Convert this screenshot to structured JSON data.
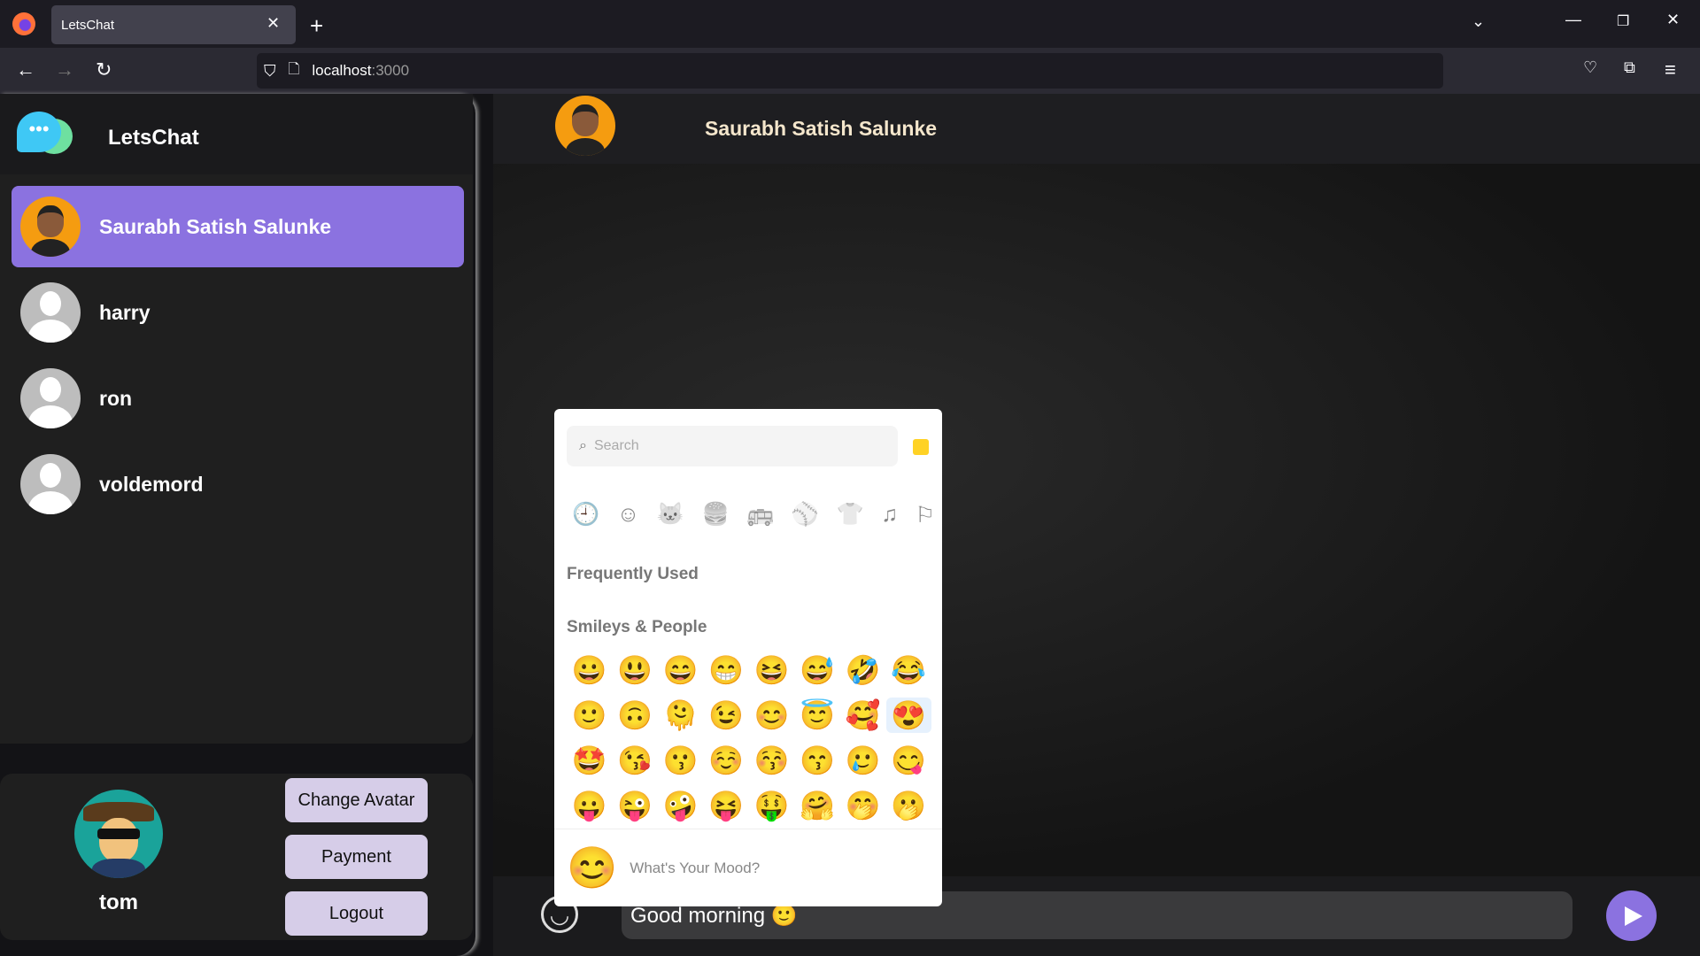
{
  "browser": {
    "tab_title": "LetsChat",
    "url_host": "localhost",
    "url_port": ":3000"
  },
  "app": {
    "name": "LetsChat"
  },
  "contacts": [
    {
      "name": "Saurabh Satish Salunke",
      "selected": true
    },
    {
      "name": "harry"
    },
    {
      "name": "ron"
    },
    {
      "name": "voldemord"
    }
  ],
  "current_user": {
    "name": "tom"
  },
  "buttons": {
    "change_avatar": "Change Avatar",
    "payment": "Payment",
    "logout": "Logout"
  },
  "chat": {
    "contact_name": "Saurabh Satish Salunke",
    "message_input": "Good morning 🙂"
  },
  "emoji_picker": {
    "search_placeholder": "Search",
    "tone_color": "#ffd225",
    "categories": [
      "🕘",
      "☺",
      "🐱",
      "🍔",
      "🚌",
      "⚾",
      "👕",
      "♫",
      "⚐"
    ],
    "frequently_used_label": "Frequently Used",
    "smileys_label": "Smileys & People",
    "emojis": [
      "😀",
      "😃",
      "😄",
      "😁",
      "😆",
      "😅",
      "🤣",
      "😂",
      "🙂",
      "🙃",
      "🫠",
      "😉",
      "😊",
      "😇",
      "🥰",
      "😍",
      "🤩",
      "😘",
      "😗",
      "☺️",
      "😚",
      "😙",
      "🥲",
      "😋",
      "😛",
      "😜",
      "🤪",
      "😝",
      "🤑",
      "🤗",
      "🤭",
      "🫢"
    ],
    "preview_emoji": "😊",
    "preview_text": "What's Your Mood?"
  },
  "colors": {
    "accent": "#8b72e0",
    "button": "#d6cde8"
  }
}
